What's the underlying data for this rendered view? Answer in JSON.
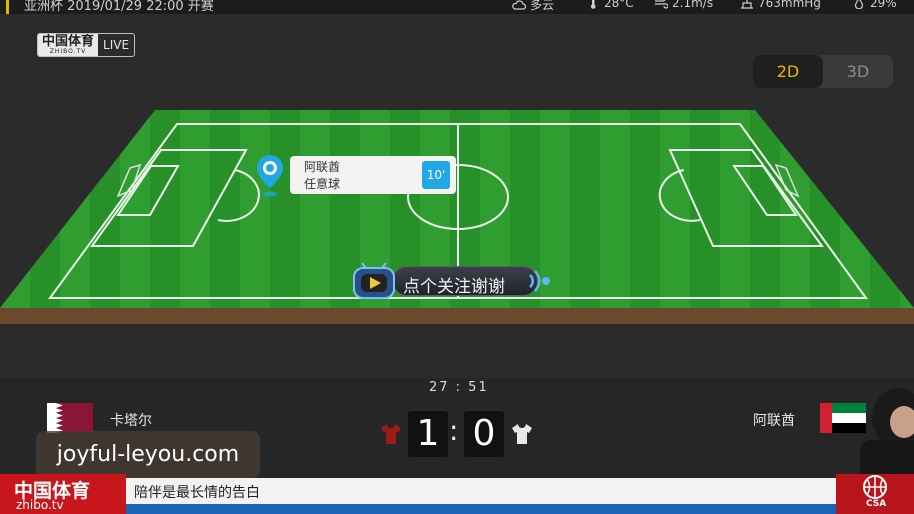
{
  "header": {
    "match_title": "亚洲杯 2019/01/29 22:00 开赛",
    "weather": [
      {
        "icon": "cloud-icon",
        "text": "多云"
      },
      {
        "icon": "thermometer-icon",
        "text": "28°C"
      },
      {
        "icon": "wind-icon",
        "text": "2.1m/s"
      },
      {
        "icon": "pressure-icon",
        "text": "763mmHg"
      },
      {
        "icon": "humidity-icon",
        "text": "29%"
      }
    ]
  },
  "brand": {
    "cn": "中国体育",
    "sub": "ZHIBO.TV",
    "live": "LIVE"
  },
  "view_toggle": {
    "options": [
      "2D",
      "3D"
    ],
    "selected": "2D",
    "accent": "#e8b400"
  },
  "field": {
    "grass": "#2e9a2e",
    "line": "#ffffff"
  },
  "event": {
    "team": "阿联酋",
    "description": "任意球",
    "minute": "10'",
    "accent": "#20a7e6"
  },
  "follow_prompt": {
    "text": "点个关注谢谢"
  },
  "scoreboard": {
    "clock": "27 : 51",
    "home": {
      "name": "卡塔尔",
      "score": "1",
      "flag": "qatar-flag-icon"
    },
    "away": {
      "name": "阿联酋",
      "score": "0",
      "flag": "uae-flag-icon"
    },
    "separator": ":"
  },
  "watermark": {
    "text": "joyful-leyou.com"
  },
  "ticker": {
    "brand_cn": "中国体育",
    "brand_en": "zhibo.tv",
    "message": "陪伴是最长情的告白",
    "badge": "CSA"
  }
}
